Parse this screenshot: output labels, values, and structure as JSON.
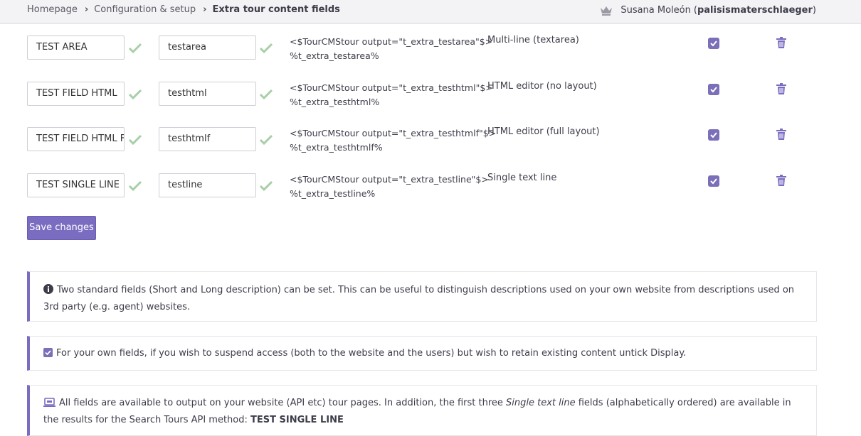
{
  "breadcrumb": {
    "home": "Homepage",
    "config": "Configuration & setup",
    "current": "Extra tour content fields"
  },
  "user": {
    "name": "Susana Moleón",
    "login_open": "(",
    "login": "palisismaterschlaeger",
    "login_close": ")",
    "icon": "crown-icon"
  },
  "rows": [
    {
      "label_value": "TEST AREA",
      "key_value": "testarea",
      "code_line1": "<$TourCMStour output=\"t_extra_testarea\"$>",
      "code_line2": "%t_extra_testarea%",
      "type": "Multi-line (textarea)",
      "display_checked": true
    },
    {
      "label_value": "TEST FIELD HTML",
      "key_value": "testhtml",
      "code_line1": "<$TourCMStour output=\"t_extra_testhtml\"$>",
      "code_line2": "%t_extra_testhtml%",
      "type": "HTML editor (no layout)",
      "display_checked": true
    },
    {
      "label_value": "TEST FIELD HTML FU",
      "key_value": "testhtmlf",
      "code_line1": "<$TourCMStour output=\"t_extra_testhtmlf\"$>",
      "code_line2": "%t_extra_testhtmlf%",
      "type": "HTML editor (full layout)",
      "display_checked": true
    },
    {
      "label_value": "TEST SINGLE LINE",
      "key_value": "testline",
      "code_line1": "<$TourCMStour output=\"t_extra_testline\"$>",
      "code_line2": "%t_extra_testline%",
      "type": "Single text line",
      "display_checked": true
    }
  ],
  "save_button": "Save changes",
  "notes": {
    "info": "Two standard fields (Short and Long description) can be set. This can be useful to distinguish descriptions used on your own website from descriptions used on 3rd party (e.g. agent) websites.",
    "display": "For your own fields, if you wish to suspend access (both to the website and the users) but wish to retain existing content untick Display.",
    "api_part1": "All fields are available to output on your website (API etc) tour pages. In addition, the first three ",
    "api_italic": "Single text line",
    "api_part2": " fields (alphabetically ordered) are available in the results for the Search Tours API method: ",
    "api_bold": "TEST SINGLE LINE"
  },
  "colors": {
    "accent": "#7a6cc0",
    "check_ok": "#a8cfa8",
    "topbar": "#f3f3f5"
  }
}
